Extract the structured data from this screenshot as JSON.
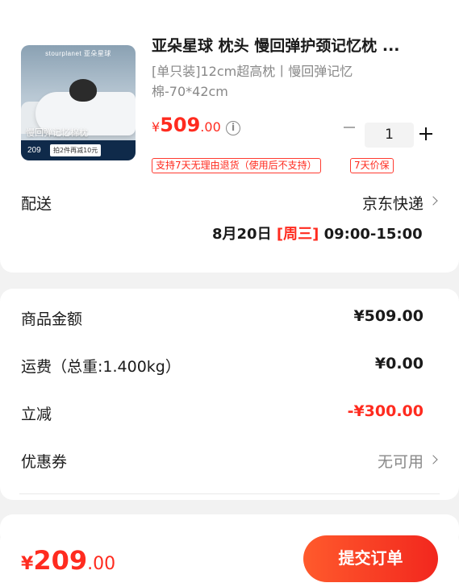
{
  "product": {
    "thumbnail": {
      "brand": "stourplanet 亚朵星球",
      "caption": "慢回弹记忆棉枕",
      "badge_price": "209",
      "badge_promo": "拍2件再减10元"
    },
    "title": "亚朵星球 枕头 慢回弹护颈记忆枕 ...",
    "spec": "[单只装]12cm超高枕丨慢回弹记忆棉-70*42cm",
    "price": {
      "currency": "¥",
      "integer": "509",
      "decimal": ".00"
    },
    "quantity": "1",
    "tags": [
      "支持7天无理由退货（使用后不支持）",
      "7天价保"
    ]
  },
  "delivery": {
    "label": "配送",
    "method": "京东快递",
    "date": "8月20日",
    "weekday": "[周三]",
    "time": "09:00-15:00"
  },
  "summary": {
    "rows": [
      {
        "label": "商品金额",
        "value": "¥509.00"
      },
      {
        "label": "运费（总重:1.400kg）",
        "value": "¥0.00"
      },
      {
        "label": "立减",
        "value": "-¥300.00"
      },
      {
        "label": "优惠券",
        "value": "无可用"
      }
    ]
  },
  "footer": {
    "total": {
      "currency": "¥",
      "integer": "209",
      "decimal": ".00"
    },
    "submit_label": "提交订单"
  },
  "colors": {
    "accent": "#ff2b1f",
    "button_start": "#ff5a2c",
    "button_end": "#f2271e",
    "background": "#f2f2f2"
  },
  "icons": [
    "info-icon",
    "minus-icon",
    "plus-icon",
    "chevron-right-icon"
  ]
}
